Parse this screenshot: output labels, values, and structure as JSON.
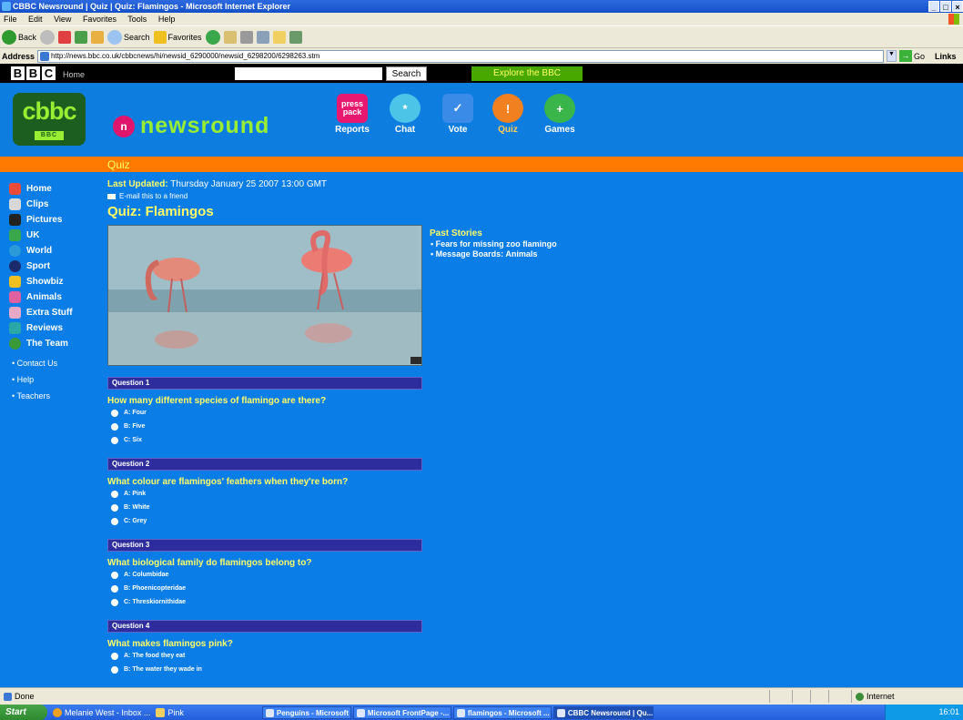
{
  "window": {
    "title": "CBBC Newsround | Quiz | Quiz: Flamingos - Microsoft Internet Explorer",
    "menus": [
      "File",
      "Edit",
      "View",
      "Favorites",
      "Tools",
      "Help"
    ],
    "toolbar": {
      "back": "Back",
      "search": "Search",
      "favorites": "Favorites"
    },
    "address_label": "Address",
    "address_url": "http://news.bbc.co.uk/cbbcnews/hi/newsid_6290000/newsid_6298200/6298263.stm",
    "go_label": "Go",
    "links_label": "Links"
  },
  "bbc_bar": {
    "logo": [
      "B",
      "B",
      "C"
    ],
    "home": "Home",
    "search_value": "",
    "search_button": "Search",
    "explore": "Explore the BBC"
  },
  "banner": {
    "cbbc": "cbbc",
    "cbbc_sub": "BBC",
    "newsround": "newsround",
    "nav": [
      {
        "label": "Reports",
        "icon_text": "press pack",
        "color": "#e8176f"
      },
      {
        "label": "Chat",
        "icon_text": "*",
        "color": "#4cc4e8"
      },
      {
        "label": "Vote",
        "icon_text": "✓",
        "color": "#3a8be8"
      },
      {
        "label": "Quiz",
        "icon_text": "!",
        "color": "#f08020"
      },
      {
        "label": "Games",
        "icon_text": "+",
        "color": "#39b54a"
      }
    ]
  },
  "section": "Quiz",
  "left_nav": [
    {
      "label": "Home",
      "color": "#e84b3a"
    },
    {
      "label": "Clips",
      "color": "#d8d8d8"
    },
    {
      "label": "Pictures",
      "color": "#222222"
    },
    {
      "label": "UK",
      "color": "#3aa84a"
    },
    {
      "label": "World",
      "color": "#2a9ad8"
    },
    {
      "label": "Sport",
      "color": "#1a2a6a"
    },
    {
      "label": "Showbiz",
      "color": "#f0c020"
    },
    {
      "label": "Animals",
      "color": "#e060a0"
    },
    {
      "label": "Extra Stuff",
      "color": "#e8a8c8"
    },
    {
      "label": "Reviews",
      "color": "#2aa8a8"
    },
    {
      "label": "The Team",
      "color": "#3a9a3a"
    }
  ],
  "left_links": [
    "• Contact Us",
    "• Help",
    "• Teachers"
  ],
  "article": {
    "updated_label": "Last Updated:",
    "updated_value": "Thursday January 25 2007 13:00 GMT",
    "email": "E-mail this to a friend",
    "headline": "Quiz: Flamingos"
  },
  "past_stories": {
    "title": "Past Stories",
    "links": [
      "Fears for missing zoo flamingo",
      "Message Boards: Animals"
    ]
  },
  "questions": [
    {
      "label": "Question 1",
      "text": "How many different species of flamingo are there?",
      "options": [
        "A: Four",
        "B: Five",
        "C: Six"
      ]
    },
    {
      "label": "Question 2",
      "text": "What colour are flamingos' feathers when they're born?",
      "options": [
        "A: Pink",
        "B: White",
        "C: Grey"
      ]
    },
    {
      "label": "Question 3",
      "text": "What biological family do flamingos belong to?",
      "options": [
        "A: Columbidae",
        "B: Phoenicopteridae",
        "C: Threskiornithidae"
      ]
    },
    {
      "label": "Question 4",
      "text": "What makes flamingos pink?",
      "options": [
        "A: The food they eat",
        "B: The water they wade in"
      ]
    }
  ],
  "status": {
    "left": "Done",
    "zone": "Internet"
  },
  "taskbar": {
    "start": "Start",
    "quick": [
      {
        "label": "Melanie West - Inbox ...",
        "color": "#f0a020"
      },
      {
        "label": "Pink",
        "color": "#f0d060"
      }
    ],
    "tasks": [
      "Penguins - Microsoft ...",
      "Microsoft FrontPage -...",
      "flamingos - Microsoft ...",
      "CBBC Newsround | Qu..."
    ],
    "clock": "16:01"
  }
}
